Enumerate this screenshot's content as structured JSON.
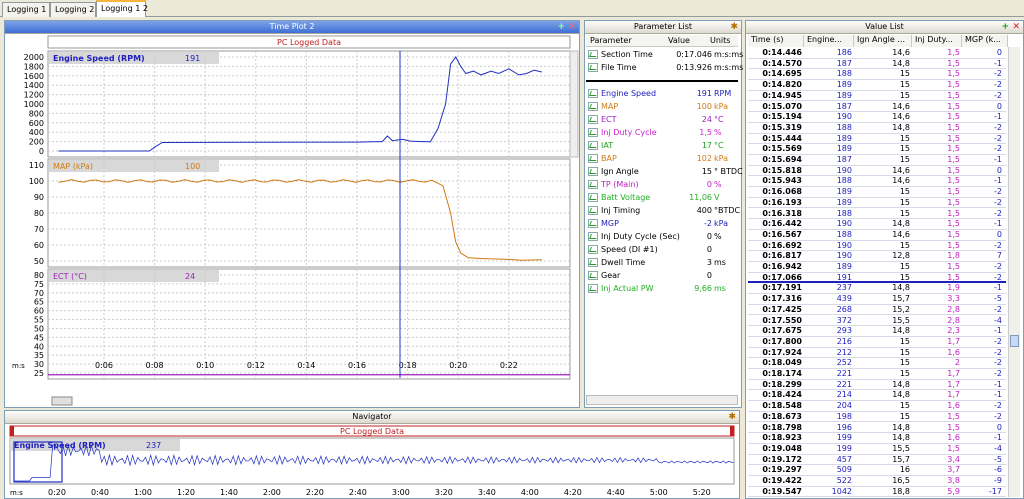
{
  "tabs": [
    {
      "label": "Logging 1"
    },
    {
      "label": "Logging 2"
    },
    {
      "label": "Logging 1 2",
      "active": true
    }
  ],
  "time_plot": {
    "title": "Time Plot 2",
    "subtitle": "PC Logged Data",
    "time_unit": "m:s",
    "x_ticks": [
      "0:06",
      "0:08",
      "0:10",
      "0:12",
      "0:14",
      "0:16",
      "0:18",
      "0:20",
      "0:22"
    ],
    "channels": [
      {
        "name": "Engine Speed (RPM)",
        "value": "191",
        "color": "#2020c0",
        "ticks": [
          "2000",
          "1800",
          "1600",
          "1400",
          "1200",
          "1000",
          "800",
          "600",
          "400",
          "200",
          "0"
        ]
      },
      {
        "name": "MAP (kPa)",
        "value": "100",
        "color": "#d07a10",
        "ticks": [
          "110",
          "100",
          "90",
          "80",
          "70",
          "60",
          "50"
        ]
      },
      {
        "name": "ECT (°C)",
        "value": "24",
        "color": "#a020c0",
        "ticks": [
          "80",
          "75",
          "70",
          "65",
          "60",
          "55",
          "50",
          "45",
          "40",
          "35",
          "30",
          "25"
        ]
      }
    ]
  },
  "navigator": {
    "title": "Navigator",
    "subtitle": "PC Logged Data",
    "channel": "Engine Speed (RPM)",
    "value": "237",
    "time_unit": "m:s",
    "x_ticks": [
      "0:20",
      "0:40",
      "1:00",
      "1:20",
      "1:40",
      "2:00",
      "2:20",
      "2:40",
      "3:00",
      "3:20",
      "3:40",
      "4:00",
      "4:20",
      "4:40",
      "5:00",
      "5:20"
    ]
  },
  "parameter_list": {
    "title": "Parameter List",
    "headers": {
      "parameter": "Parameter",
      "value": "Value",
      "units": "Units"
    },
    "summary": [
      {
        "name": "Section Time",
        "value": "0:17.046",
        "unit": "m:s:ms",
        "color": "#000000"
      },
      {
        "name": "File Time",
        "value": "0:13.926",
        "unit": "m:s:ms",
        "color": "#000000"
      }
    ],
    "rows": [
      {
        "name": "Engine Speed",
        "value": "191",
        "unit": "RPM",
        "color": "#2020c0"
      },
      {
        "name": "MAP",
        "value": "100",
        "unit": "kPa",
        "color": "#d07a10"
      },
      {
        "name": "ECT",
        "value": "24",
        "unit": "°C",
        "color": "#a020c0"
      },
      {
        "name": "Inj Duty Cycle",
        "value": "1,5",
        "unit": "%",
        "color": "#d020d0"
      },
      {
        "name": "IAT",
        "value": "17",
        "unit": "°C",
        "color": "#20a020"
      },
      {
        "name": "BAP",
        "value": "102",
        "unit": "kPa",
        "color": "#d07a10"
      },
      {
        "name": "Ign Angle",
        "value": "15",
        "unit": "° BTDC",
        "color": "#000000"
      },
      {
        "name": "TP (Main)",
        "value": "0",
        "unit": "%",
        "color": "#c020c0"
      },
      {
        "name": "Batt Voltage",
        "value": "11,06",
        "unit": "V",
        "color": "#20b020"
      },
      {
        "name": "Inj Timing",
        "value": "400",
        "unit": "°BTDC",
        "color": "#000000"
      },
      {
        "name": "MGP",
        "value": "-2",
        "unit": "kPa",
        "color": "#2020c0"
      },
      {
        "name": "Inj Duty Cycle (Sec)",
        "value": "0",
        "unit": "%",
        "color": "#000000"
      },
      {
        "name": "Speed (DI #1)",
        "value": "0",
        "unit": "",
        "color": "#000000"
      },
      {
        "name": "Dwell Time",
        "value": "3",
        "unit": "ms",
        "color": "#000000"
      },
      {
        "name": "Gear",
        "value": "0",
        "unit": "",
        "color": "#000000"
      },
      {
        "name": "Inj Actual PW",
        "value": "9,66",
        "unit": "ms",
        "color": "#20b020"
      }
    ]
  },
  "value_list": {
    "title": "Value List",
    "headers": [
      "Time (s)",
      "Engine...",
      "Ign Angle ...",
      "Inj Duty...",
      "MGP (k..."
    ],
    "rows": [
      [
        "0:14.446",
        "186",
        "14,6",
        "1,5",
        "0"
      ],
      [
        "0:14.570",
        "187",
        "14,8",
        "1,5",
        "-1"
      ],
      [
        "0:14.695",
        "188",
        "15",
        "1,5",
        "-2"
      ],
      [
        "0:14.820",
        "189",
        "15",
        "1,5",
        "-2"
      ],
      [
        "0:14.945",
        "189",
        "15",
        "1,5",
        "-2"
      ],
      [
        "0:15.070",
        "187",
        "14,6",
        "1,5",
        "0"
      ],
      [
        "0:15.194",
        "190",
        "14,6",
        "1,5",
        "-1"
      ],
      [
        "0:15.319",
        "188",
        "14,8",
        "1,5",
        "-2"
      ],
      [
        "0:15.444",
        "189",
        "15",
        "1,5",
        "-2"
      ],
      [
        "0:15.569",
        "189",
        "15",
        "1,5",
        "-2"
      ],
      [
        "0:15.694",
        "187",
        "15",
        "1,5",
        "-1"
      ],
      [
        "0:15.818",
        "190",
        "14,6",
        "1,5",
        "0"
      ],
      [
        "0:15.943",
        "188",
        "14,6",
        "1,5",
        "-1"
      ],
      [
        "0:16.068",
        "189",
        "15",
        "1,5",
        "-2"
      ],
      [
        "0:16.193",
        "189",
        "15",
        "1,5",
        "-2"
      ],
      [
        "0:16.318",
        "188",
        "15",
        "1,5",
        "-2"
      ],
      [
        "0:16.442",
        "190",
        "14,8",
        "1,5",
        "-1"
      ],
      [
        "0:16.567",
        "188",
        "14,6",
        "1,5",
        "0"
      ],
      [
        "0:16.692",
        "190",
        "15",
        "1,5",
        "-2"
      ],
      [
        "0:16.817",
        "190",
        "12,8",
        "1,8",
        "7"
      ],
      [
        "0:16.942",
        "189",
        "15",
        "1,5",
        "-2"
      ],
      [
        "0:17.066",
        "191",
        "15",
        "1,5",
        "-2"
      ],
      [
        "0:17.191",
        "237",
        "14,8",
        "1,9",
        "-1"
      ],
      [
        "0:17.316",
        "439",
        "15,7",
        "3,3",
        "-5"
      ],
      [
        "0:17.425",
        "268",
        "15,2",
        "2,8",
        "-2"
      ],
      [
        "0:17.550",
        "372",
        "15,5",
        "2,8",
        "-4"
      ],
      [
        "0:17.675",
        "293",
        "14,8",
        "2,3",
        "-1"
      ],
      [
        "0:17.800",
        "216",
        "15",
        "1,7",
        "-2"
      ],
      [
        "0:17.924",
        "212",
        "15",
        "1,6",
        "-2"
      ],
      [
        "0:18.049",
        "252",
        "15",
        "2",
        "-2"
      ],
      [
        "0:18.174",
        "221",
        "15",
        "1,7",
        "-2"
      ],
      [
        "0:18.299",
        "221",
        "14,8",
        "1,7",
        "-1"
      ],
      [
        "0:18.424",
        "214",
        "14,8",
        "1,7",
        "-1"
      ],
      [
        "0:18.548",
        "204",
        "15",
        "1,6",
        "-2"
      ],
      [
        "0:18.673",
        "198",
        "15",
        "1,5",
        "-2"
      ],
      [
        "0:18.798",
        "196",
        "14,8",
        "1,5",
        "0"
      ],
      [
        "0:18.923",
        "199",
        "14,8",
        "1,6",
        "-1"
      ],
      [
        "0:19.048",
        "199",
        "15,5",
        "1,5",
        "-4"
      ],
      [
        "0:19.172",
        "457",
        "15,7",
        "3,4",
        "-5"
      ],
      [
        "0:19.297",
        "509",
        "16",
        "3,7",
        "-6"
      ],
      [
        "0:19.422",
        "522",
        "16,5",
        "3,8",
        "-9"
      ],
      [
        "0:19.547",
        "1042",
        "18,8",
        "5,9",
        "-17"
      ]
    ],
    "current_row": 21
  }
}
